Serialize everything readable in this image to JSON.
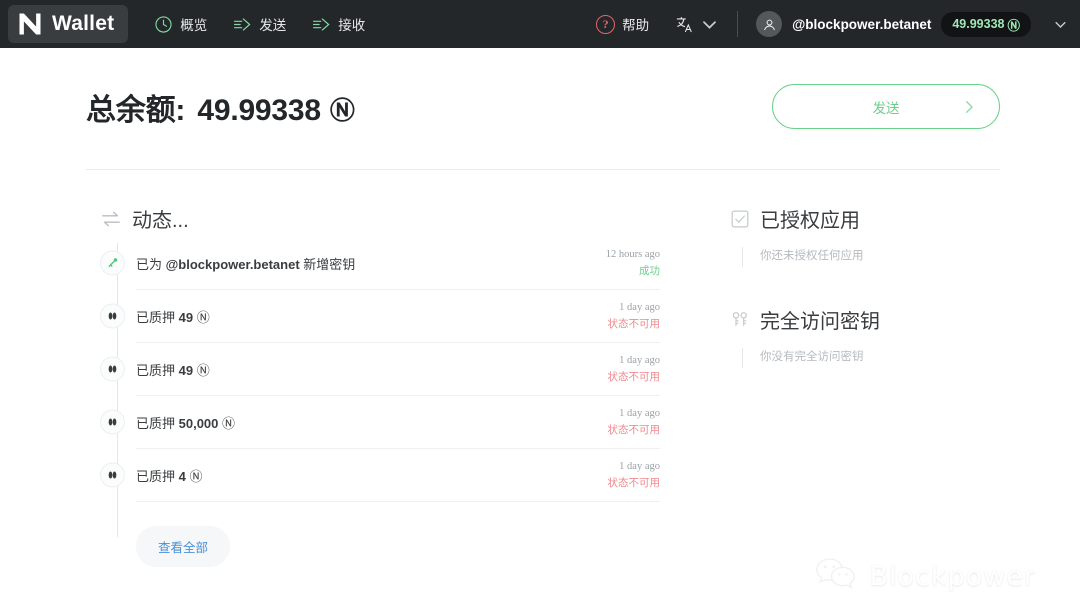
{
  "header": {
    "brand": "Wallet",
    "logo_icon": "near-logo-icon",
    "nav": [
      {
        "label": "概览",
        "icon": "clock-icon"
      },
      {
        "label": "发送",
        "icon": "send-arrow-icon"
      },
      {
        "label": "接收",
        "icon": "receive-arrow-icon"
      }
    ],
    "help_label": "帮助",
    "help_icon": "question-circle-icon",
    "help_color": "#e4646a",
    "lang_icon": "translate-icon",
    "account_name": "@blockpower.betanet",
    "account_balance": "49.99338",
    "account_balance_symbol": "Ⓝ",
    "balance_pill_color": "#9fe8b6",
    "avatar_icon": "user-avatar-icon"
  },
  "balance": {
    "label": "总余额:",
    "amount": "49.99338",
    "symbol": "Ⓝ",
    "send_button": "发送",
    "send_button_color": "#6bcf8b"
  },
  "activity": {
    "title": "动态...",
    "title_icon": "exchange-arrows-icon",
    "rows": [
      {
        "icon": "key-icon",
        "icon_color": "#4cc97a",
        "text_prefix": "已为 ",
        "text_account": "@blockpower.betanet",
        "text_suffix": " 新增密钥",
        "time": "12 hours ago",
        "status": "成功",
        "status_type": "ok"
      },
      {
        "icon": "stake-coins-icon",
        "icon_color": "#3a3d40",
        "text_prefix": "已质押 ",
        "text_account": "49",
        "text_suffix": " Ⓝ",
        "time": "1 day ago",
        "status": "状态不可用",
        "status_type": "bad"
      },
      {
        "icon": "stake-coins-icon",
        "icon_color": "#3a3d40",
        "text_prefix": "已质押 ",
        "text_account": "49",
        "text_suffix": " Ⓝ",
        "time": "1 day ago",
        "status": "状态不可用",
        "status_type": "bad"
      },
      {
        "icon": "stake-coins-icon",
        "icon_color": "#3a3d40",
        "text_prefix": "已质押 ",
        "text_account": "50,000",
        "text_suffix": " Ⓝ",
        "time": "1 day ago",
        "status": "状态不可用",
        "status_type": "bad"
      },
      {
        "icon": "stake-coins-icon",
        "icon_color": "#3a3d40",
        "text_prefix": "已质押 ",
        "text_account": "4",
        "text_suffix": " Ⓝ",
        "time": "1 day ago",
        "status": "状态不可用",
        "status_type": "bad"
      }
    ],
    "view_all": "查看全部",
    "view_all_color": "#4a90d9"
  },
  "side": {
    "blocks": [
      {
        "title": "已授权应用",
        "icon": "checkbox-check-icon",
        "empty": "你还未授权任何应用"
      },
      {
        "title": "完全访问密钥",
        "icon": "two-keys-icon",
        "empty": "你没有完全访问密钥"
      }
    ]
  },
  "watermark": {
    "text": "Blockpower",
    "icon": "wechat-icon"
  }
}
